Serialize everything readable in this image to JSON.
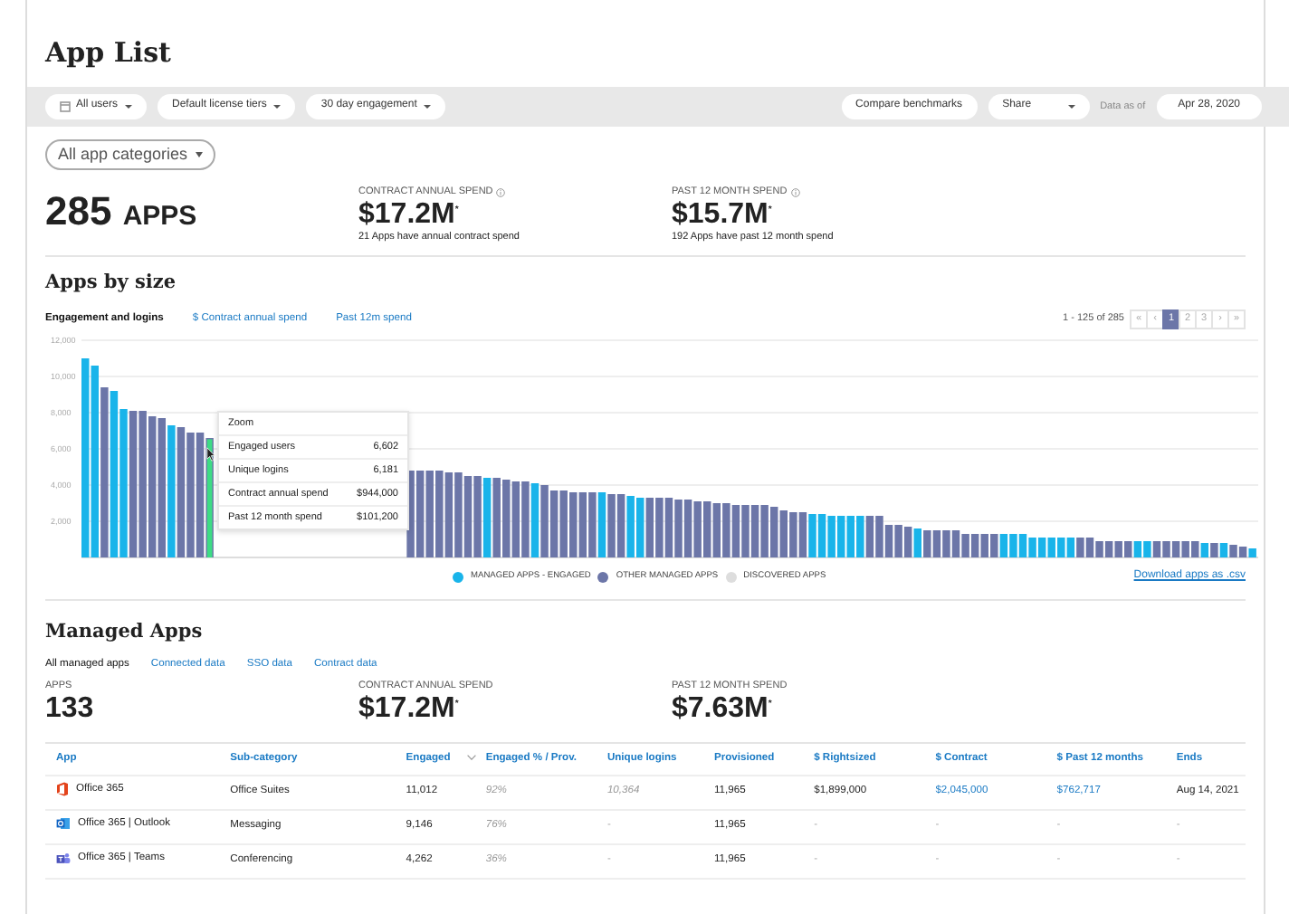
{
  "title": "App List",
  "toolbar": {
    "left": [
      {
        "label": "All users",
        "kind": "select"
      },
      {
        "label": "Default license tiers",
        "kind": "dropdown"
      },
      {
        "label": "30 day engagement",
        "kind": "dropdown"
      }
    ],
    "right": [
      {
        "label": "Compare benchmarks",
        "kind": "button"
      },
      {
        "label": "Share",
        "kind": "select"
      }
    ],
    "date_label": "Data as of",
    "date": "Apr 28, 2020"
  },
  "category_filter": "All app categories",
  "summary": {
    "count": "285",
    "unit": "APPS",
    "metrics": [
      {
        "label": "CONTRACT ANNUAL SPEND",
        "info": true,
        "value": "$17.2M$^{*}$",
        "note": "21 Apps have annual contract spend"
      },
      {
        "label": "PAST 12 MONTH SPEND",
        "info": true,
        "value": "$15.7M$^{*}$",
        "note": "192 Apps have past 12 month spend"
      }
    ]
  },
  "apps_by_size": {
    "heading": "Apps by size",
    "tabs": [
      {
        "label": "Engagement and logins",
        "selected": true
      },
      {
        "label": "$ Contract annual spend",
        "selected": false
      },
      {
        "label": "Past 12m spend",
        "selected": false
      }
    ],
    "pagination": {
      "summary": "1 - 125 of 285",
      "pages": [
        {
          "label": "«",
          "selected": false
        },
        {
          "label": "‹",
          "selected": false
        },
        {
          "label": "1",
          "selected": true
        },
        {
          "label": "2",
          "selected": false
        },
        {
          "label": "3",
          "selected": false
        },
        {
          "label": "›",
          "selected": false
        },
        {
          "label": "»",
          "selected": false
        }
      ]
    },
    "chart_data": {
      "type": "bar",
      "stacked": true,
      "grid": true,
      "ylim": [
        0,
        12000
      ],
      "yticks": [
        {
          "value": 2000,
          "label": "2,000"
        },
        {
          "value": 4000,
          "label": "4,000"
        },
        {
          "value": 6000,
          "label": "6,000"
        },
        {
          "value": 8000,
          "label": "8,000"
        },
        {
          "value": 10000,
          "label": "10,000"
        },
        {
          "value": 12000,
          "label": "12,000"
        }
      ],
      "series": [
        {
          "name": "MANAGED APPS - ENGAGED",
          "color": "#19b4ea",
          "values": [
            11000,
            10600,
            null,
            9200,
            8200,
            null,
            null,
            null,
            null,
            7300,
            null,
            null,
            null,
            null,
            null,
            null,
            null,
            null,
            null,
            null,
            null,
            null,
            null,
            null,
            null,
            null,
            null,
            null,
            null,
            null,
            null,
            null,
            null,
            null,
            null,
            null,
            null,
            null,
            null,
            null,
            null,
            null,
            4400,
            null,
            null,
            null,
            null,
            4100,
            null,
            null,
            null,
            null,
            null,
            null,
            3600,
            null,
            null,
            3400,
            3300,
            null,
            null,
            null,
            null,
            null,
            null,
            null,
            null,
            null,
            null,
            null,
            null,
            null,
            null,
            null,
            null,
            null,
            2400,
            2400,
            2300,
            2300,
            2300,
            2300,
            null,
            null,
            null,
            null,
            null,
            1600,
            null,
            null,
            null,
            null,
            null,
            null,
            null,
            null,
            1300,
            1300,
            1300,
            1100,
            1100,
            1100,
            1100,
            1100,
            null,
            null,
            null,
            null,
            null,
            null,
            900,
            900,
            null,
            null,
            null,
            null,
            null,
            800,
            null,
            800,
            null,
            null,
            500
          ]
        },
        {
          "name": "OTHER MANAGED APPS",
          "color": "#6c76a8",
          "values": [
            null,
            null,
            9400,
            null,
            null,
            8100,
            8100,
            7800,
            7700,
            null,
            7200,
            6900,
            6900,
            6600,
            null,
            null,
            null,
            null,
            null,
            null,
            null,
            null,
            null,
            null,
            null,
            null,
            null,
            null,
            null,
            null,
            null,
            null,
            null,
            null,
            4800,
            4800,
            4800,
            4800,
            4700,
            4700,
            4500,
            4500,
            null,
            4400,
            4300,
            4200,
            4200,
            null,
            4000,
            3700,
            3700,
            3600,
            3600,
            3600,
            null,
            3500,
            3500,
            null,
            null,
            3300,
            3300,
            3300,
            3200,
            3200,
            3100,
            3100,
            3000,
            3000,
            2900,
            2900,
            2900,
            2900,
            2800,
            2600,
            2500,
            2500,
            null,
            null,
            null,
            null,
            null,
            null,
            2300,
            2300,
            1800,
            1800,
            1700,
            null,
            1500,
            1500,
            1500,
            1500,
            1300,
            1300,
            1300,
            1300,
            null,
            null,
            null,
            null,
            null,
            null,
            null,
            null,
            1100,
            1100,
            900,
            900,
            900,
            900,
            null,
            null,
            900,
            900,
            900,
            900,
            900,
            null,
            800,
            null,
            700,
            600,
            null
          ]
        },
        {
          "name": "DISCOVERED APPS",
          "color": "#dddddd",
          "values": [
            null,
            null,
            null,
            null,
            null,
            null,
            null,
            null,
            null,
            null,
            null,
            null,
            null,
            null,
            null,
            null,
            null,
            null,
            null,
            null,
            null,
            null,
            null,
            null,
            null,
            null,
            null,
            null,
            null,
            null,
            null,
            null,
            null,
            null,
            null,
            null,
            null,
            null,
            null,
            null,
            null,
            null,
            null,
            null,
            null,
            null,
            null,
            null,
            null,
            null,
            null,
            null,
            null,
            null,
            null,
            null,
            null,
            null,
            null,
            null,
            null,
            null,
            null,
            null,
            null,
            null,
            null,
            null,
            null,
            null,
            null,
            null,
            null,
            null,
            null,
            null,
            null,
            null,
            null,
            null,
            null,
            null,
            null,
            null,
            null,
            null,
            null,
            null,
            null,
            null,
            null,
            null,
            null,
            null,
            null,
            null,
            null,
            null,
            null,
            null,
            null,
            null,
            null,
            null,
            null,
            null,
            null,
            null,
            null,
            null,
            null,
            null,
            null,
            null,
            null,
            null,
            null,
            null,
            null,
            null,
            null,
            null,
            null
          ]
        }
      ]
    },
    "tooltip": {
      "hovered": true,
      "title": "Zoom",
      "rows": [
        {
          "label": "Engaged users",
          "value": "6,602"
        },
        {
          "label": "Unique logins",
          "value": "6,181"
        },
        {
          "label": "Contract annual spend",
          "value": "$944,000"
        },
        {
          "label": "Past 12 month spend",
          "value": "$101,200"
        }
      ]
    },
    "download_link": "Download apps as .csv"
  },
  "managed_apps": {
    "heading": "Managed Apps",
    "tabs": [
      {
        "label": "All managed apps",
        "selected": true
      },
      {
        "label": "Connected data",
        "selected": false
      },
      {
        "label": "SSO data",
        "selected": false
      },
      {
        "label": "Contract data",
        "selected": false
      }
    ],
    "metrics": [
      {
        "label": "APPS",
        "value": "133"
      },
      {
        "label": "CONTRACT ANNUAL SPEND",
        "value": "$17.2M$^{*}$"
      },
      {
        "label": "PAST 12 MONTH SPEND",
        "value": "$7.63M$^{*}$"
      }
    ],
    "table": {
      "columns": [
        {
          "label": "App"
        },
        {
          "label": "Sub-category"
        },
        {
          "label": "Engaged",
          "sorted": true
        },
        {
          "label": "Engaged % / Prov."
        },
        {
          "label": "Unique logins"
        },
        {
          "label": "Provisioned"
        },
        {
          "label": "$ Rightsized"
        },
        {
          "label": "$ Contract"
        },
        {
          "label": "$ Past 12 months"
        },
        {
          "label": "Ends"
        }
      ],
      "rows": [
        {
          "cells": [
            {
              "text": "Office 365",
              "kind": "text"
            },
            {
              "text": "Office Suites",
              "kind": "text"
            },
            {
              "text": "11,012",
              "kind": "text"
            },
            {
              "text": "92%",
              "kind": "muted"
            },
            {
              "text": "10,364",
              "kind": "muted"
            },
            {
              "text": "11,965",
              "kind": "text"
            },
            {
              "text": "$1,899,000",
              "kind": "text"
            },
            {
              "text": "$2,045,000",
              "kind": "link"
            },
            {
              "text": "$762,717",
              "kind": "link"
            },
            {
              "text": "Aug 14, 2021",
              "kind": "text"
            }
          ]
        },
        {
          "cells": [
            {
              "text": "Office 365 | Outlook",
              "kind": "text"
            },
            {
              "text": "Messaging",
              "kind": "text"
            },
            {
              "text": "9,146",
              "kind": "text"
            },
            {
              "text": "76%",
              "kind": "muted"
            },
            {
              "text": "-",
              "kind": "dash"
            },
            {
              "text": "11,965",
              "kind": "text"
            },
            {
              "text": "-",
              "kind": "dash"
            },
            {
              "text": "-",
              "kind": "dash"
            },
            {
              "text": "-",
              "kind": "dash"
            },
            {
              "text": "-",
              "kind": "dash"
            }
          ]
        },
        {
          "cells": [
            {
              "text": "Office 365 | Teams",
              "kind": "text"
            },
            {
              "text": "Conferencing",
              "kind": "text"
            },
            {
              "text": "4,262",
              "kind": "text"
            },
            {
              "text": "36%",
              "kind": "muted"
            },
            {
              "text": "-",
              "kind": "dash"
            },
            {
              "text": "11,965",
              "kind": "text"
            },
            {
              "text": "-",
              "kind": "dash"
            },
            {
              "text": "-",
              "kind": "dash"
            },
            {
              "text": "-",
              "kind": "dash"
            },
            {
              "text": "-",
              "kind": "dash"
            }
          ]
        }
      ]
    }
  }
}
